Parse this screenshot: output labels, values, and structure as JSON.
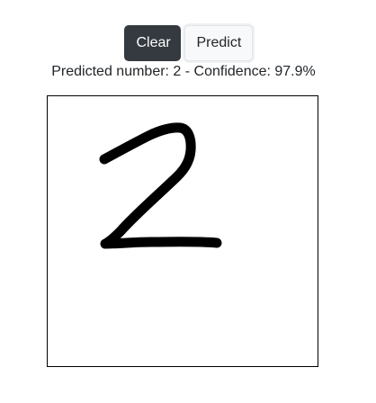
{
  "toolbar": {
    "clear_label": "Clear",
    "predict_label": "Predict"
  },
  "result": {
    "text": "Predicted number: 2 - Confidence: 97.9%",
    "predicted_number": 2,
    "confidence_percent": 97.9
  },
  "canvas": {
    "background": "#ffffff",
    "border_color": "#000000",
    "stroke_color": "#000000",
    "drawn_digit": "2"
  },
  "colors": {
    "clear_button_bg": "#343a40",
    "predict_button_bg": "#f8f9fa",
    "text": "#212529"
  }
}
